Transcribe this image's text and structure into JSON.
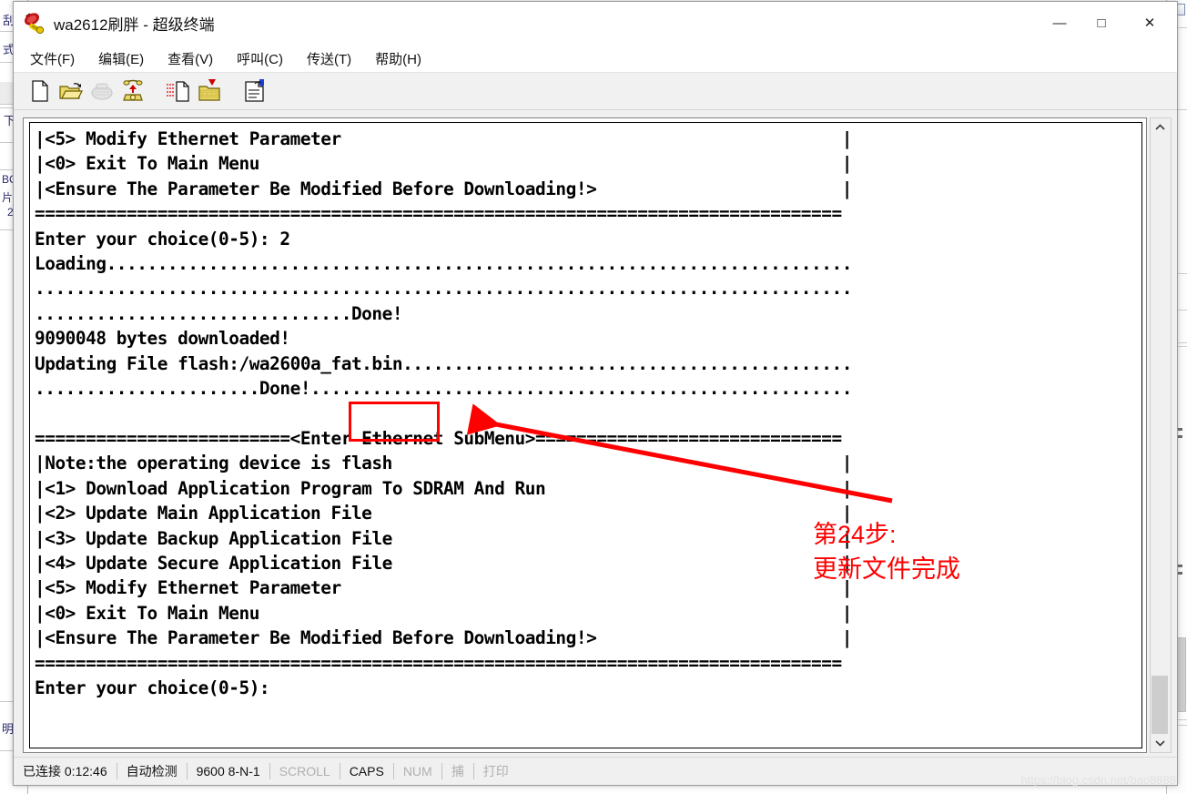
{
  "background": {
    "left_window": {
      "fragments": [
        "刮",
        "式",
        "下",
        "BC",
        "片",
        "2",
        "明"
      ]
    },
    "right_window": {
      "fragments": []
    }
  },
  "window": {
    "title": "wa2612刷胖 - 超级终端",
    "icon": "hyperterminal-icon",
    "controls": {
      "minimize": "—",
      "maximize": "□",
      "close": "✕"
    }
  },
  "menubar": {
    "items": [
      {
        "label": "文件(F)",
        "name": "menu-file"
      },
      {
        "label": "编辑(E)",
        "name": "menu-edit"
      },
      {
        "label": "查看(V)",
        "name": "menu-view"
      },
      {
        "label": "呼叫(C)",
        "name": "menu-call"
      },
      {
        "label": "传送(T)",
        "name": "menu-transfer"
      },
      {
        "label": "帮助(H)",
        "name": "menu-help"
      }
    ]
  },
  "toolbar": {
    "buttons": [
      {
        "icon": "new-document-icon",
        "enabled": true
      },
      {
        "icon": "open-folder-icon",
        "enabled": true
      },
      {
        "icon": "phone-dial-icon",
        "enabled": false
      },
      {
        "icon": "phone-hangup-icon",
        "enabled": true
      },
      {
        "icon": "send-file-icon",
        "enabled": true
      },
      {
        "icon": "receive-file-icon",
        "enabled": true
      },
      {
        "icon": "properties-icon",
        "enabled": true
      }
    ]
  },
  "terminal": {
    "lines": [
      "|<5> Modify Ethernet Parameter                                                 |",
      "|<0> Exit To Main Menu                                                         |",
      "|<Ensure The Parameter Be Modified Before Downloading!>                        |",
      "===============================================================================",
      "Enter your choice(0-5): 2",
      "Loading.........................................................................",
      "................................................................................",
      "...............................Done!",
      "9090048 bytes downloaded!",
      "Updating File flash:/wa2600a_fat.bin............................................",
      "......................Done!.....................................................",
      "",
      "=========================<Enter Ethernet SubMenu>==============================",
      "|Note:the operating device is flash                                            |",
      "|<1> Download Application Program To SDRAM And Run                             |",
      "|<2> Update Main Application File                                              |",
      "|<3> Update Backup Application File                                            |",
      "|<4> Update Secure Application File                                            |",
      "|<5> Modify Ethernet Parameter                                                 |",
      "|<0> Exit To Main Menu                                                         |",
      "|<Ensure The Parameter Be Modified Before Downloading!>                        |",
      "===============================================================================",
      "Enter your choice(0-5):"
    ]
  },
  "annotation": {
    "highlight_target": "Done!",
    "step_label": "第24步:",
    "step_detail": "更新文件完成",
    "color": "#fe0000"
  },
  "scrollbar": {
    "up_arrow": "▲",
    "down_arrow": "▼"
  },
  "statusbar": {
    "connection": "已连接 0:12:46",
    "detect": "自动检测",
    "serial": "9600 8-N-1",
    "scroll": "SCROLL",
    "caps": "CAPS",
    "num": "NUM",
    "capture": "捕",
    "print": "打印"
  },
  "watermark": "https://blog.csdn.net/bao8888"
}
